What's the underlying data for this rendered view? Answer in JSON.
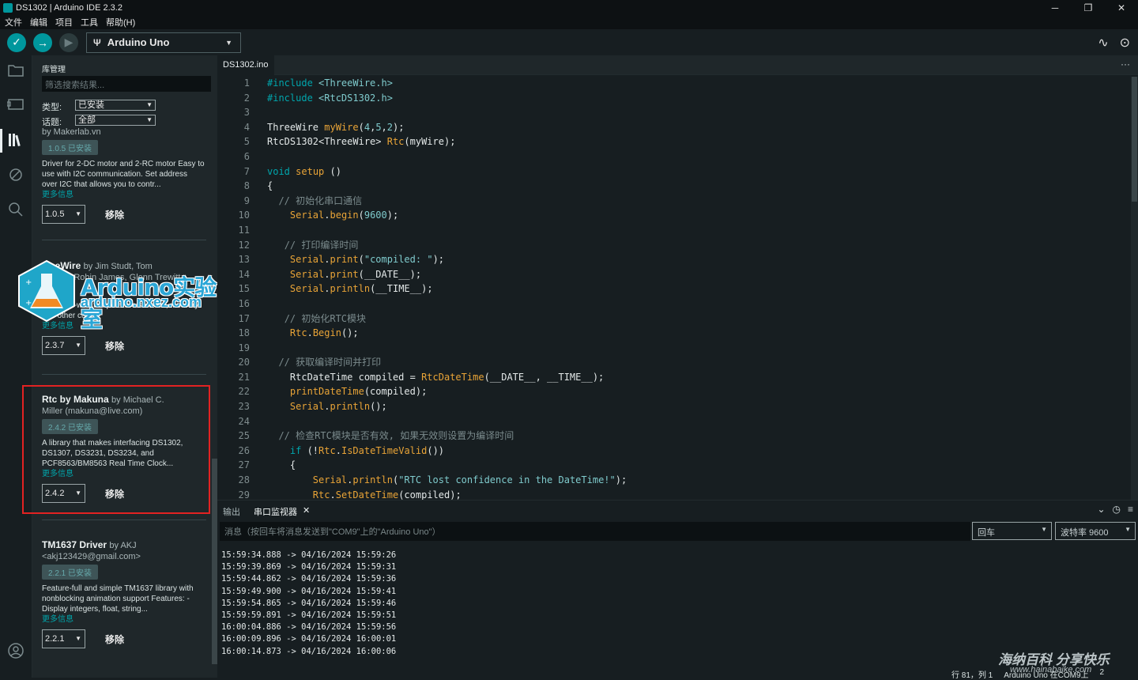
{
  "window": {
    "title": "DS1302 | Arduino IDE 2.3.2",
    "buttons": [
      "─",
      "❐",
      "✕"
    ]
  },
  "menu": [
    "文件",
    "编辑",
    "项目",
    "工具",
    "帮助(H)"
  ],
  "toolbar": {
    "board": "Arduino Uno"
  },
  "library_panel": {
    "title": "库管理",
    "filter_placeholder": "筛选搜索结果...",
    "type_label": "类型:",
    "type_value": "已安装",
    "topic_label": "话题:",
    "topic_value": "全部",
    "cards": [
      {
        "author_line": "by Makerlab.vn",
        "badge": "1.0.5 已安装",
        "desc": "Driver for 2-DC motor and 2-RC motor Easy to use with I2C communication. Set address over I2C that allows you to contr...",
        "more": "更多信息",
        "version": "1.0.5",
        "remove": "移除"
      },
      {
        "name": "OneWire",
        "by": "by Jim Studt, Tom",
        "author2": "Pollard, Robin James, Glenn Trewitt, ...",
        "desc": "Access 1-wire temperature sensors, memory and other chips.",
        "more": "更多信息",
        "version": "2.3.7",
        "remove": "移除"
      },
      {
        "name": "Rtc by Makuna",
        "by": "by Michael C.",
        "author2": "Miller (makuna@live.com)",
        "badge": "2.4.2 已安装",
        "desc": "A library that makes interfacing DS1302, DS1307, DS3231, DS3234, and PCF8563/BM8563 Real Time Clock...",
        "more": "更多信息",
        "version": "2.4.2",
        "remove": "移除"
      },
      {
        "name": "TM1637 Driver",
        "by": "by AKJ",
        "author2": "<akj123429@gmail.com>",
        "badge": "2.2.1 已安装",
        "desc": "Feature-full and simple TM1637 library with nonblocking animation support Features: -Display integers, float, string...",
        "more": "更多信息",
        "version": "2.2.1",
        "remove": "移除"
      }
    ]
  },
  "editor": {
    "tab": "DS1302.ino",
    "more": "···"
  },
  "bottom_panel": {
    "tab_output": "输出",
    "tab_serial": "串口监视器",
    "tab_close": "✕",
    "message_placeholder": "消息（按回车将消息发送到\"COM9\"上的\"Arduino Uno\"）",
    "line_ending": "回车",
    "baud": "波特率 9600",
    "serial_lines": [
      "15:59:34.888 -> 04/16/2024 15:59:26",
      "15:59:39.869 -> 04/16/2024 15:59:31",
      "15:59:44.862 -> 04/16/2024 15:59:36",
      "15:59:49.900 -> 04/16/2024 15:59:41",
      "15:59:54.865 -> 04/16/2024 15:59:46",
      "15:59:59.891 -> 04/16/2024 15:59:51",
      "16:00:04.886 -> 04/16/2024 15:59:56",
      "16:00:09.896 -> 04/16/2024 16:00:01",
      "16:00:14.873 -> 04/16/2024 16:00:06"
    ]
  },
  "status": {
    "position": "行 81，列 1",
    "board_port": "Arduino Uno 在COM9上",
    "count": "2"
  },
  "watermarks": {
    "logo_title": "Arduino实验室",
    "logo_url": "arduino.nxez.com",
    "corner_title": "海纳百科 分享快乐",
    "corner_url": "www.hainabaike.com"
  },
  "colors": {
    "accent": "#00979d",
    "highlight_box": "#e22222"
  }
}
